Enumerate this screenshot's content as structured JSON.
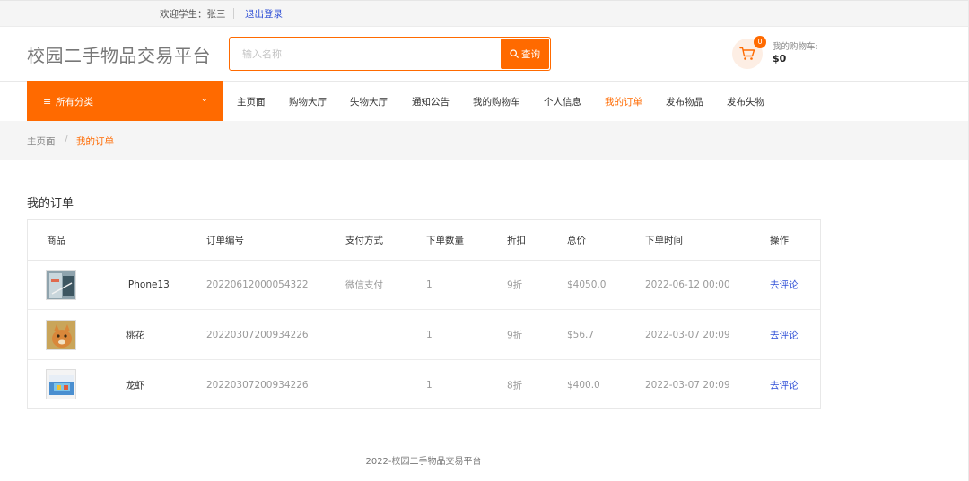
{
  "topbar": {
    "welcome": "欢迎学生：张三",
    "logout": "退出登录"
  },
  "header": {
    "site_title": "校园二手物品交易平台",
    "search_placeholder": "输入名称",
    "search_button": "查询",
    "cart_count": "0",
    "cart_label": "我的购物车:",
    "cart_amount": "$0"
  },
  "colors": {
    "accent": "#ff6a00",
    "link": "#2f4fd6"
  },
  "icons": {
    "search": "search-icon",
    "cart": "cart-icon",
    "menu": "hamburger-icon",
    "chevron": "chevron-down-icon"
  },
  "nav": {
    "category_label": "所有分类",
    "items": [
      {
        "label": "主页面",
        "active": false
      },
      {
        "label": "购物大厅",
        "active": false
      },
      {
        "label": "失物大厅",
        "active": false
      },
      {
        "label": "通知公告",
        "active": false
      },
      {
        "label": "我的购物车",
        "active": false
      },
      {
        "label": "个人信息",
        "active": false
      },
      {
        "label": "我的订单",
        "active": true
      },
      {
        "label": "发布物品",
        "active": false
      },
      {
        "label": "发布失物",
        "active": false
      }
    ]
  },
  "breadcrumb": {
    "home": "主页面",
    "separator": "/",
    "current": "我的订单"
  },
  "page_title": "我的订单",
  "table": {
    "headers": [
      "商品",
      "订单编号",
      "支付方式",
      "下单数量",
      "折扣",
      "总价",
      "下单时间",
      "操作"
    ],
    "rows": [
      {
        "name": "iPhone13",
        "order_no": "20220612000054322",
        "payment": "微信支付",
        "quantity": "1",
        "discount": "9折",
        "total": "$4050.0",
        "time": "2022-06-12 00:00",
        "action": "去评论"
      },
      {
        "name": "桃花",
        "order_no": "20220307200934226",
        "payment": "",
        "quantity": "1",
        "discount": "9折",
        "total": "$56.7",
        "time": "2022-03-07 20:09",
        "action": "去评论"
      },
      {
        "name": "龙虾",
        "order_no": "20220307200934226",
        "payment": "",
        "quantity": "1",
        "discount": "8折",
        "total": "$400.0",
        "time": "2022-03-07 20:09",
        "action": "去评论"
      }
    ]
  },
  "footer": "2022-校园二手物品交易平台"
}
